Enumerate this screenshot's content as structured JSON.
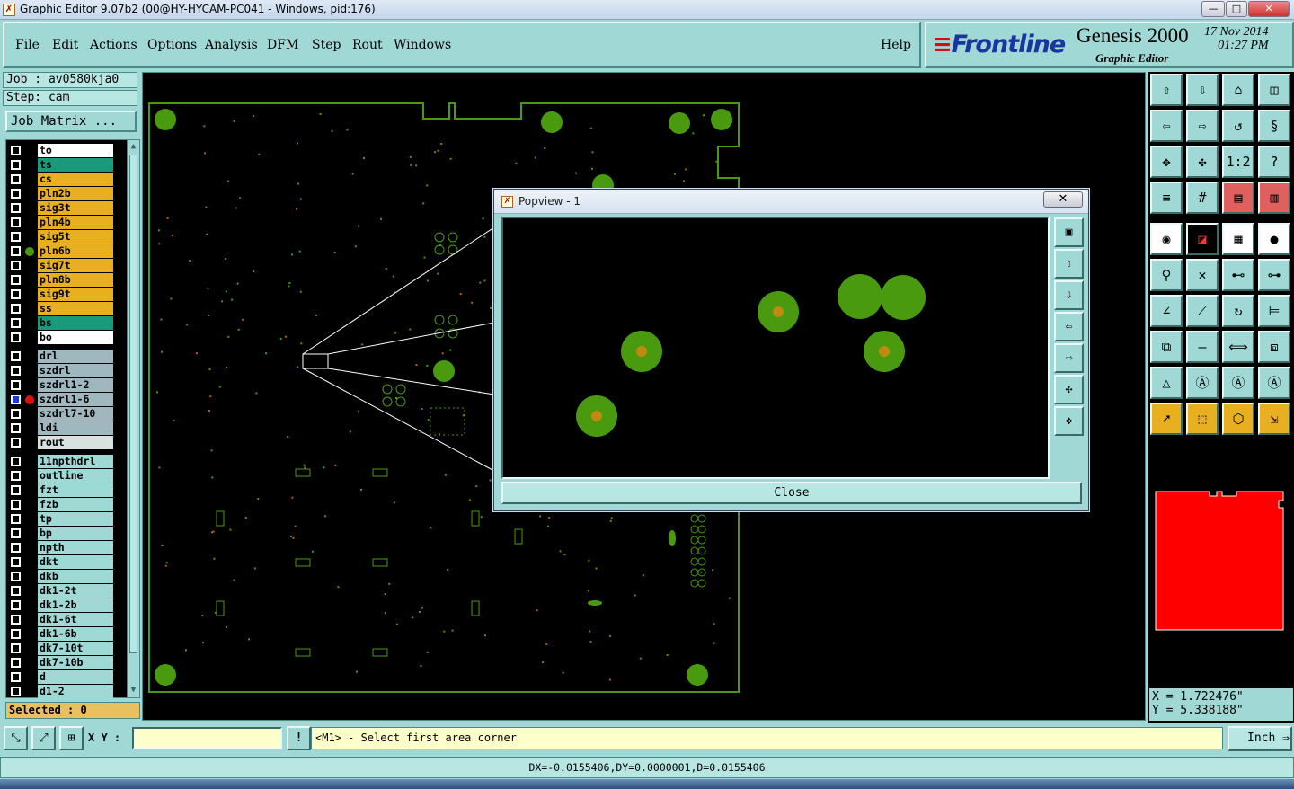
{
  "window": {
    "title": "Graphic Editor 9.07b2 (00@HY-HYCAM-PC041 - Windows, pid:176)",
    "min": "—",
    "max": "□",
    "close": "✕"
  },
  "menu": {
    "items": [
      "File",
      "Edit",
      "Actions",
      "Options",
      "Analysis",
      "DFM",
      "Step",
      "Rout",
      "Windows"
    ],
    "help": "Help"
  },
  "brand": {
    "logo": "Frontline",
    "product": "Genesis 2000",
    "subtitle": "Graphic Editor",
    "date": "17 Nov 2014",
    "time": "01:27 PM"
  },
  "job": {
    "job_label": "Job : av0580kja0",
    "step_label": "Step: cam",
    "matrix_button": "Job Matrix ..."
  },
  "layers": [
    {
      "name": "to",
      "color": "#ffffff",
      "dot": ""
    },
    {
      "name": "ts",
      "color": "#1a9a7a",
      "dot": ""
    },
    {
      "name": "cs",
      "color": "#e8b020",
      "dot": ""
    },
    {
      "name": "pln2b",
      "color": "#e8b020",
      "dot": ""
    },
    {
      "name": "sig3t",
      "color": "#e8b020",
      "dot": ""
    },
    {
      "name": "pln4b",
      "color": "#e8b020",
      "dot": ""
    },
    {
      "name": "sig5t",
      "color": "#e8b020",
      "dot": ""
    },
    {
      "name": "pln6b",
      "color": "#e8b020",
      "dot": "#4a9a10"
    },
    {
      "name": "sig7t",
      "color": "#e8b020",
      "dot": ""
    },
    {
      "name": "pln8b",
      "color": "#e8b020",
      "dot": ""
    },
    {
      "name": "sig9t",
      "color": "#e8b020",
      "dot": ""
    },
    {
      "name": "ss",
      "color": "#e8b020",
      "dot": ""
    },
    {
      "name": "bs",
      "color": "#1a9a7a",
      "dot": ""
    },
    {
      "name": "bo",
      "color": "#ffffff",
      "dot": ""
    },
    {
      "name": "drl",
      "color": "#9fb8c0",
      "dot": ""
    },
    {
      "name": "szdrl",
      "color": "#9fb8c0",
      "dot": ""
    },
    {
      "name": "szdrl1-2",
      "color": "#9fb8c0",
      "dot": ""
    },
    {
      "name": "szdrl1-6",
      "color": "#9fb8c0",
      "dot": "#e01010"
    },
    {
      "name": "szdrl7-10",
      "color": "#9fb8c0",
      "dot": ""
    },
    {
      "name": "ldi",
      "color": "#9fb8c0",
      "dot": ""
    },
    {
      "name": "rout",
      "color": "#d8e0e0",
      "dot": ""
    },
    {
      "name": "11npthdrl",
      "color": "#9fd8d4",
      "dot": ""
    },
    {
      "name": "outline",
      "color": "#9fd8d4",
      "dot": ""
    },
    {
      "name": "fzt",
      "color": "#9fd8d4",
      "dot": ""
    },
    {
      "name": "fzb",
      "color": "#9fd8d4",
      "dot": ""
    },
    {
      "name": "tp",
      "color": "#9fd8d4",
      "dot": ""
    },
    {
      "name": "bp",
      "color": "#9fd8d4",
      "dot": ""
    },
    {
      "name": "npth",
      "color": "#9fd8d4",
      "dot": ""
    },
    {
      "name": "dkt",
      "color": "#9fd8d4",
      "dot": ""
    },
    {
      "name": "dkb",
      "color": "#9fd8d4",
      "dot": ""
    },
    {
      "name": "dk1-2t",
      "color": "#9fd8d4",
      "dot": ""
    },
    {
      "name": "dk1-2b",
      "color": "#9fd8d4",
      "dot": ""
    },
    {
      "name": "dk1-6t",
      "color": "#9fd8d4",
      "dot": ""
    },
    {
      "name": "dk1-6b",
      "color": "#9fd8d4",
      "dot": ""
    },
    {
      "name": "dk7-10t",
      "color": "#9fd8d4",
      "dot": ""
    },
    {
      "name": "dk7-10b",
      "color": "#9fd8d4",
      "dot": ""
    },
    {
      "name": "d",
      "color": "#9fd8d4",
      "dot": ""
    },
    {
      "name": "d1-2",
      "color": "#9fd8d4",
      "dot": ""
    }
  ],
  "selected": "Selected : 0",
  "popview": {
    "title": "Popview - 1",
    "close_x": "✕",
    "close_button": "Close"
  },
  "status": {
    "xy_label": "X Y :",
    "xy_value": "",
    "alert": "!",
    "prompt": "<M1> - Select first area corner",
    "unit": "Inch",
    "unit_arrow": "⇒"
  },
  "coords": {
    "x": "X = 1.722476\"",
    "y": "Y = 5.338188\""
  },
  "measure": "DX=-0.0155406,DY=0.0000001,D=0.0155406",
  "colors": {
    "board": "#4a9a10",
    "highlight": "#e01010",
    "panel": "#9fd8d4"
  }
}
